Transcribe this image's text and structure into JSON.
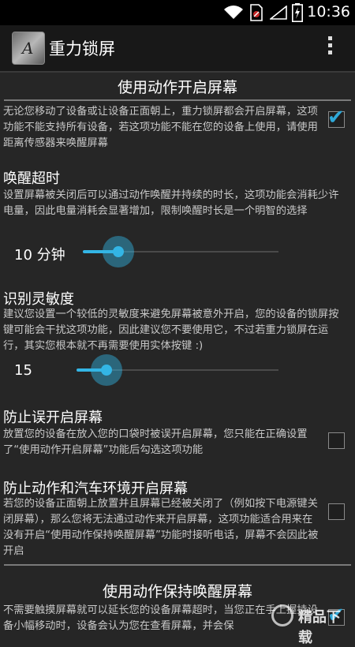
{
  "status_bar": {
    "time": "10:36",
    "icons": [
      "wifi-icon",
      "no-sim-icon",
      "signal-icon",
      "battery-charging-icon"
    ]
  },
  "action_bar": {
    "app_icon_letter": "A",
    "title": "重力锁屏",
    "overflow_icon": "overflow-menu-icon"
  },
  "sections": [
    {
      "header": "使用动作开启屏幕",
      "description": "无论您移动了设备或让设备正面朝上，重力锁屏都会开启屏幕，这项功能不能支持所有设备，若这项功能不能在您的设备上使用，请使用距离传感器来唤醒屏幕",
      "checked": true
    }
  ],
  "wake_timeout": {
    "title": "唤醒超时",
    "description": "设置屏幕被关闭后可以通过动作唤醒并持续的时长，这项功能会消耗少许电量，因此电量消耗会显著增加，限制唤醒时长是一个明智的选择",
    "value_label": "10 分钟",
    "slider_fraction": 0.2
  },
  "sensitivity": {
    "title": "识别灵敏度",
    "description": "建议您设置一个较低的灵敏度来避免屏幕被意外开启，您的设备的锁屏按键可能会干扰这项功能，因此建议您不要使用它，不过若重力锁屏在运行，其实您根本就不再需要使用实体按键 :)",
    "value_label": "15",
    "slider_fraction": 0.15
  },
  "pocket": {
    "title": "防止误开启屏幕",
    "description": "放置您的设备在放入您的口袋时被误开启屏幕，您只能在正确设置了“使用动作开启屏幕”功能后勾选这项功能",
    "checked": false
  },
  "car": {
    "title": "防止动作和汽车环境开启屏幕",
    "description": "若您的设备正面朝上放置并且屏幕已经被关闭了（例如按下电源键关闭屏幕），那么您将无法通过动作来开启屏幕，这项功能适合用来在没有开启“使用动作保持唤醒屏幕”功能时接听电话，屏幕不会因此被开启",
    "checked": false
  },
  "keep_awake": {
    "header": "使用动作保持唤醒屏幕",
    "description": "不需要触摸屏幕就可以延长您的设备屏幕超时，当您正在手上握持设备小幅移动时，设备会认为您在查看屏幕，并会保",
    "checked": true
  },
  "watermark": {
    "text": "精品下载"
  },
  "colors": {
    "accent": "#33b5e5",
    "background": "#262626",
    "action_bar": "#181818"
  }
}
